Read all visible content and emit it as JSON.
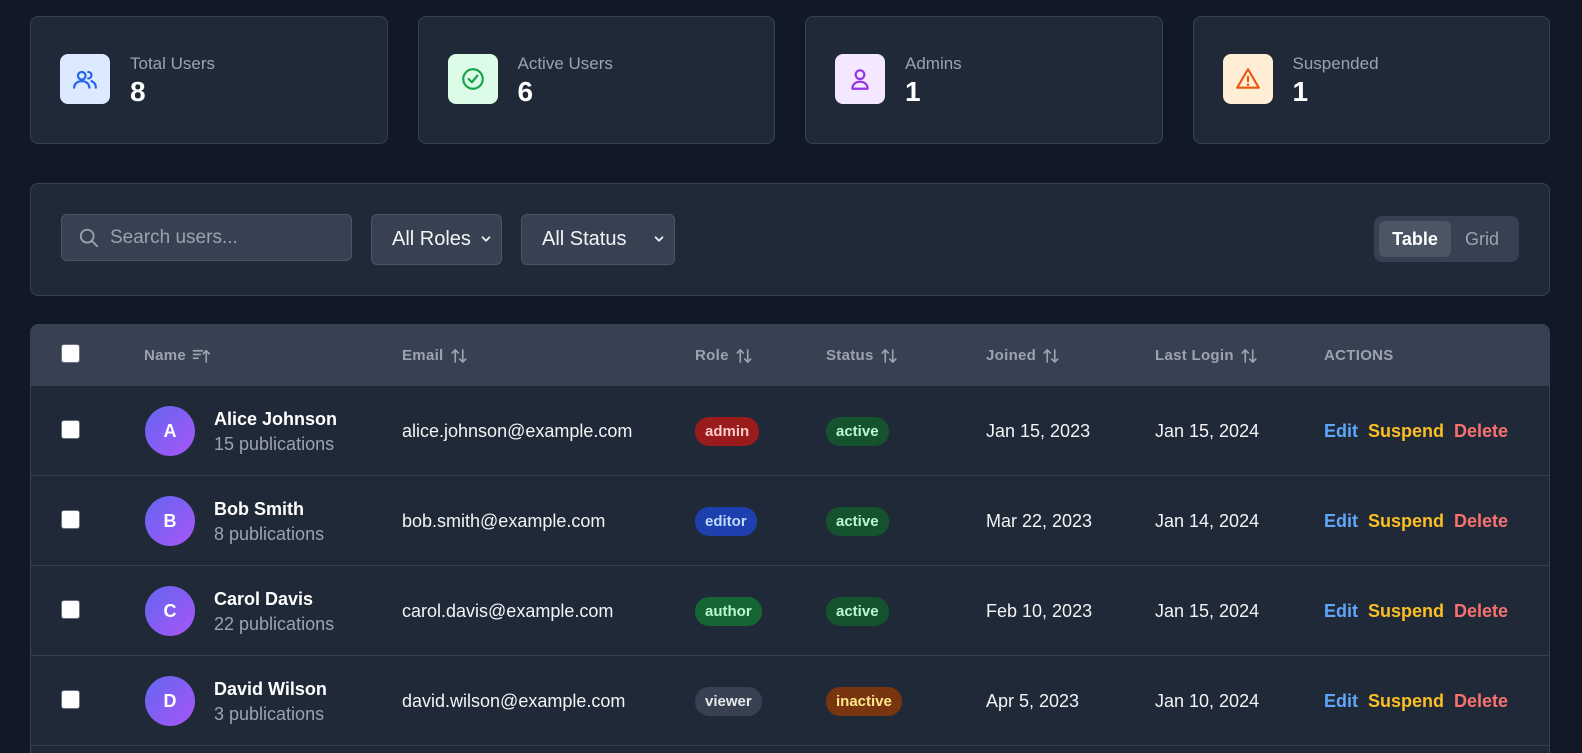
{
  "stats": [
    {
      "label": "Total Users",
      "value": "8",
      "icon": "users-icon"
    },
    {
      "label": "Active Users",
      "value": "6",
      "icon": "check-circle-icon"
    },
    {
      "label": "Admins",
      "value": "1",
      "icon": "user-icon"
    },
    {
      "label": "Suspended",
      "value": "1",
      "icon": "warning-icon"
    }
  ],
  "toolbar": {
    "search_placeholder": "Search users...",
    "role_filter": "All Roles",
    "status_filter": "All Status",
    "view_table": "Table",
    "view_grid": "Grid"
  },
  "table": {
    "headers": {
      "name": "Name",
      "email": "Email",
      "role": "Role",
      "status": "Status",
      "joined": "Joined",
      "last_login": "Last Login",
      "actions": "ACTIONS"
    },
    "actions": {
      "edit": "Edit",
      "suspend": "Suspend",
      "delete": "Delete"
    },
    "rows": [
      {
        "initial": "A",
        "name": "Alice Johnson",
        "pubs": "15 publications",
        "email": "alice.johnson@example.com",
        "role": "admin",
        "status": "active",
        "joined": "Jan 15, 2023",
        "last_login": "Jan 15, 2024"
      },
      {
        "initial": "B",
        "name": "Bob Smith",
        "pubs": "8 publications",
        "email": "bob.smith@example.com",
        "role": "editor",
        "status": "active",
        "joined": "Mar 22, 2023",
        "last_login": "Jan 14, 2024"
      },
      {
        "initial": "C",
        "name": "Carol Davis",
        "pubs": "22 publications",
        "email": "carol.davis@example.com",
        "role": "author",
        "status": "active",
        "joined": "Feb 10, 2023",
        "last_login": "Jan 15, 2024"
      },
      {
        "initial": "D",
        "name": "David Wilson",
        "pubs": "3 publications",
        "email": "david.wilson@example.com",
        "role": "viewer",
        "status": "inactive",
        "joined": "Apr 5, 2023",
        "last_login": "Jan 10, 2024"
      }
    ]
  },
  "colors": {
    "background": "#111827",
    "card": "#1f2937",
    "role_admin": "#991b1b",
    "role_editor": "#1e40af",
    "role_author": "#166534",
    "role_viewer": "#374151",
    "status_active": "#14532d",
    "status_inactive": "#78350f"
  }
}
